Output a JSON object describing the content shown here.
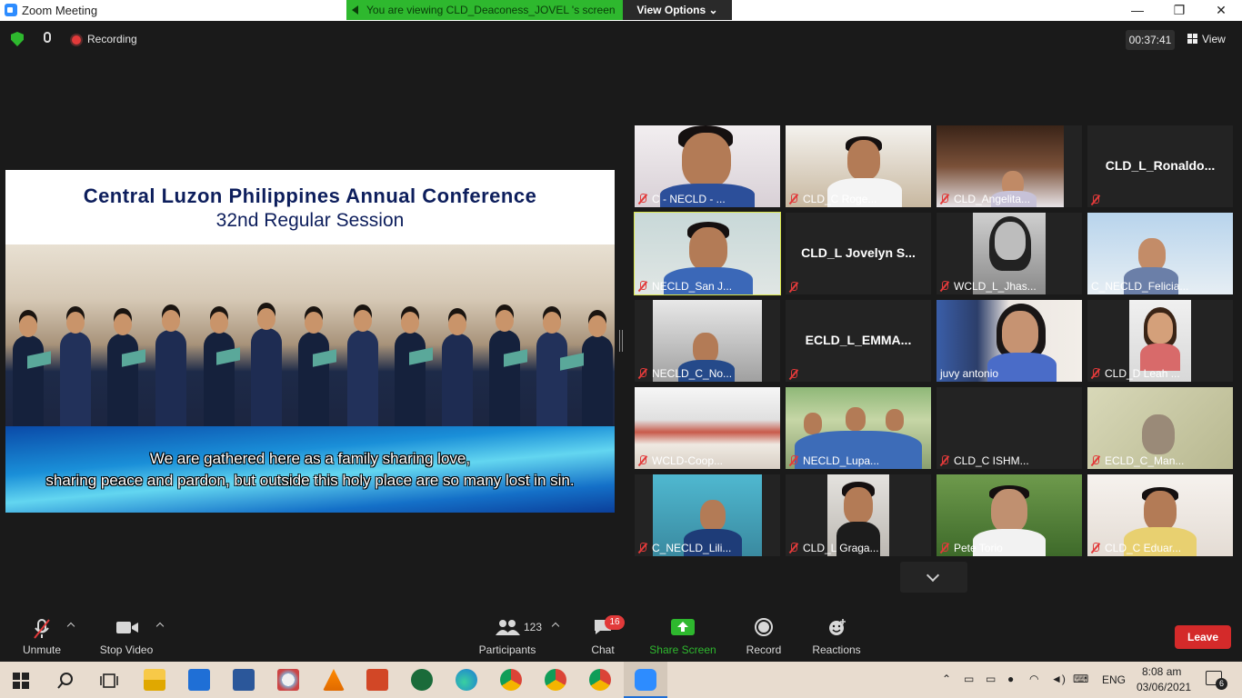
{
  "window": {
    "title": "Zoom Meeting",
    "minimize_glyph": "—",
    "restore_glyph": "❐",
    "close_glyph": "✕"
  },
  "share_banner": {
    "text": "You are viewing CLD_Deaconess_JOVEL 's screen",
    "view_options_label": "View Options",
    "chevron_glyph": "⌄",
    "color": "#2eb82e"
  },
  "top_bar": {
    "recording_label": "Recording",
    "timer": "00:37:41",
    "view_label": "View"
  },
  "shared_screen": {
    "title": "Central Luzon Philippines Annual Conference",
    "subtitle": "32nd Regular Session",
    "lyric_line1": "We are gathered here as a family sharing love,",
    "lyric_line2": "sharing peace and pardon, but outside this holy place are so many lost in sin."
  },
  "participants": [
    {
      "name": "C - NECLD - ...",
      "muted": true,
      "video": true
    },
    {
      "name": "CLD_C Roge...",
      "muted": true,
      "video": true
    },
    {
      "name": "CLD_Angelita...",
      "muted": true,
      "video": true
    },
    {
      "name": "",
      "big_name": "CLD_L_Ronaldo...",
      "muted": true,
      "video": false
    },
    {
      "name": "NECLD_San J...",
      "muted": true,
      "video": true,
      "active_speaker": true
    },
    {
      "name": "",
      "big_name": "CLD_L Jovelyn S...",
      "muted": true,
      "video": false
    },
    {
      "name": "WCLD_L_Jhas...",
      "muted": true,
      "video": true
    },
    {
      "name": "C_NECLD_Felicia...",
      "muted": false,
      "video": true
    },
    {
      "name": "NECLD_C_No...",
      "muted": true,
      "video": true
    },
    {
      "name": "",
      "big_name": "ECLD_L_EMMA...",
      "muted": true,
      "video": false
    },
    {
      "name": "juvy antonio",
      "muted": false,
      "video": true
    },
    {
      "name": "CLD_D Leah ...",
      "muted": true,
      "video": true
    },
    {
      "name": "WCLD-Coop...",
      "muted": true,
      "video": true
    },
    {
      "name": "NECLD_Lupa...",
      "muted": true,
      "video": true
    },
    {
      "name": "CLD_C ISHM...",
      "muted": true,
      "video": false
    },
    {
      "name": "ECLD_C_Man...",
      "muted": true,
      "video": true
    },
    {
      "name": "C_NECLD_Lili...",
      "muted": true,
      "video": true
    },
    {
      "name": "CLD_L Graga...",
      "muted": true,
      "video": true
    },
    {
      "name": "Pete Torio",
      "muted": true,
      "video": true
    },
    {
      "name": "CLD_C Eduar...",
      "muted": true,
      "video": true
    }
  ],
  "toolbar": {
    "unmute_label": "Unmute",
    "stop_video_label": "Stop Video",
    "participants_label": "Participants",
    "participants_count": "123",
    "chat_label": "Chat",
    "chat_badge": "16",
    "share_label": "Share Screen",
    "record_label": "Record",
    "reactions_label": "Reactions",
    "leave_label": "Leave",
    "share_color": "#2eb82e",
    "leave_color": "#d42a2a"
  },
  "taskbar": {
    "language": "ENG",
    "time": "8:08 am",
    "date": "03/06/2021",
    "notification_count": "6",
    "apps": [
      "windows-start",
      "search",
      "task-view",
      "file-explorer",
      "mail",
      "word",
      "paint",
      "vlc",
      "powerpoint",
      "upwork",
      "edge",
      "chrome",
      "chrome",
      "chrome",
      "zoom"
    ]
  }
}
